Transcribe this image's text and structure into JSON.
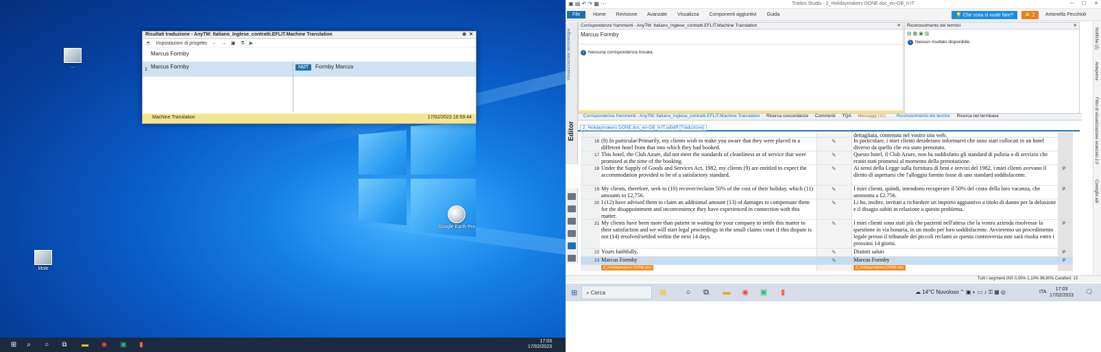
{
  "left": {
    "desktop_icons": [
      {
        "label": "..."
      },
      {
        "label": "Mole"
      },
      {
        "label": "Google Earth Pro"
      }
    ],
    "translation_window": {
      "title": "Risultati traduzione - AnyTM: Italiano_Inglese_contratti.EFLIT.Machine Translation",
      "toolbar_label": "Impostazioni di progetto",
      "source_text": "Marcus Formby",
      "result_number": "1",
      "result_source": "Marcus Formby",
      "nmt_badge": "NMT",
      "result_target": "Formby Marcus",
      "footer_provider": "Machine Translation",
      "footer_timestamp": "17/02/2023 16:59:44"
    },
    "taskbar": {
      "time": "17:03",
      "date": "17/02/2023"
    }
  },
  "right": {
    "window_title": "Trados Studio - 2_Holidaymakers DONE.doc_en-GB_it-IT",
    "ribbon": {
      "file_label": "File",
      "tabs": [
        "Home",
        "Revisione",
        "Avanzate",
        "Visualizza",
        "Componenti aggiuntivi",
        "Guida"
      ],
      "help_prompt": "Che cosa si vuole fare?",
      "notif_count": "2",
      "user_name": "Antonella Pecchioli"
    },
    "editor_label": "Editor",
    "side_label_left": "Visualizzazione terminologia",
    "side_labels_right": [
      "Notifiche (2)",
      "Anteprima",
      "Filtro di visualizzazione avanzato 2.0",
      "Consiglia adi"
    ],
    "fragment_pane": {
      "header": "Corrispondenze frammenti - AnyTM: Italiano_Inglese_contratti.EFLIT.Machine Translation",
      "source": "Marcus Formby",
      "message": "Nessuna corrispondenza trovata."
    },
    "term_pane": {
      "header": "Riconoscimento dei termini",
      "message": "Nessun risultato disponibile."
    },
    "pane_tabs": [
      "Corrispondenze frammenti - AnyTM: Italiano_Inglese_contratti.EFLIT.Machine Translation",
      "Ricerca concordanze",
      "Commenti",
      "TQA",
      "Messaggi (11)",
      "Riconoscimento dei termini",
      "Ricerca nel termbase"
    ],
    "doc_tab": "2_Holidaymakers DONE.doc_en-GB_it-IT.sdlxliff [Traduzione]",
    "segments": [
      {
        "num": "",
        "src": "",
        "tgt": "dettagliata, contenuta nel vostro sito web.",
        "status": "",
        "p": ""
      },
      {
        "num": "16",
        "src": "(8) In particular/Primarily, my clients wish to make you aware that they were placed in a different hotel from that into which they had booked.",
        "tgt": "In particolare, i miei clienti desiderano informarvi che sono stati collocati in un hotel diverso da quello che era stato prenotato.",
        "status": "✎",
        "p": ""
      },
      {
        "num": "17",
        "src": "This hotel, the Club Azure, did not meet the standards of cleanliness or of service that were promised at the time of the booking.",
        "tgt": "Questo hotel, il Club Azure, non ha soddisfatto gli standard di pulizia o di servizio che erano stati promessi al momento della prenotazione.",
        "status": "✎",
        "p": ""
      },
      {
        "num": "18",
        "src": "Under the Supply of Goods and Services Act, 1982, my clients (9) are entitled to expect the accommodation provided to be of a satisfactory standard.",
        "tgt": "Ai sensi della Legge sulla fornitura di beni e servizi del 1982, i miei clienti avevano il diritto di aspettarsi che l'alloggio fornito fosse di uno standard soddisfacente.",
        "status": "✎",
        "p": "P"
      },
      {
        "num": "19",
        "src": "My clients, therefore, seek to (10) recover/reclaim 50% of the cost of their holiday, which (11) amounts to £2,756.",
        "tgt": "I miei clienti, quindi, intendono recuperare il 50% del costo della loro vacanza, che ammonta a £2.756.",
        "status": "✎",
        "p": "P"
      },
      {
        "num": "20",
        "src": "I (12) have advised them to claim an additional amount (13) of damages to compensate them for the disappointment and inconvenience they have experienced in connection with this matter.",
        "tgt": "Li ho, inoltre, invitati a richiedere un importo aggiuntivo a titolo di danno per la delusione e il disagio subiti in relazione a questo problema.",
        "status": "✎",
        "p": ""
      },
      {
        "num": "21",
        "src": "My clients have been more than patient in waiting for your company to settle this matter to their satisfaction and we will start legal proceedings in the small claims court if this dispute is not (14) resolved/settled within the next 14 days.",
        "tgt": "I miei clienti sono stati più che pazienti nell'attesa che la vostra azienda risolvesse la questione in via bonaria, in un modo per loro soddisfacente. Avvieremo un procedimento legale presso il tribunale dei piccoli reclami se questa controversia non sarà risolta entro i prossimi 14 giorni.",
        "status": "✎",
        "p": "P"
      },
      {
        "num": "22",
        "src": "Yours faithfully,",
        "tgt": "Distinti saluti",
        "status": "✎",
        "p": "P"
      },
      {
        "num": "23",
        "src": "Marcus Formby",
        "tgt": "Marcus Formby",
        "status": "✎",
        "p": "P"
      }
    ],
    "mini_tab_src": "2_Holidaymakers DONE.doc",
    "mini_tab_tgt": "2_Holidaymakers DONE.doc",
    "status_bar": "Tutti i segmenti  INS  0,00%  1,10%  98,90%  Caratteri: 13",
    "taskbar": {
      "search_placeholder": "Cerca",
      "weather": "14°C  Nuvoloso",
      "lang": "ITA",
      "time": "17:03",
      "date": "17/02/2023"
    }
  }
}
